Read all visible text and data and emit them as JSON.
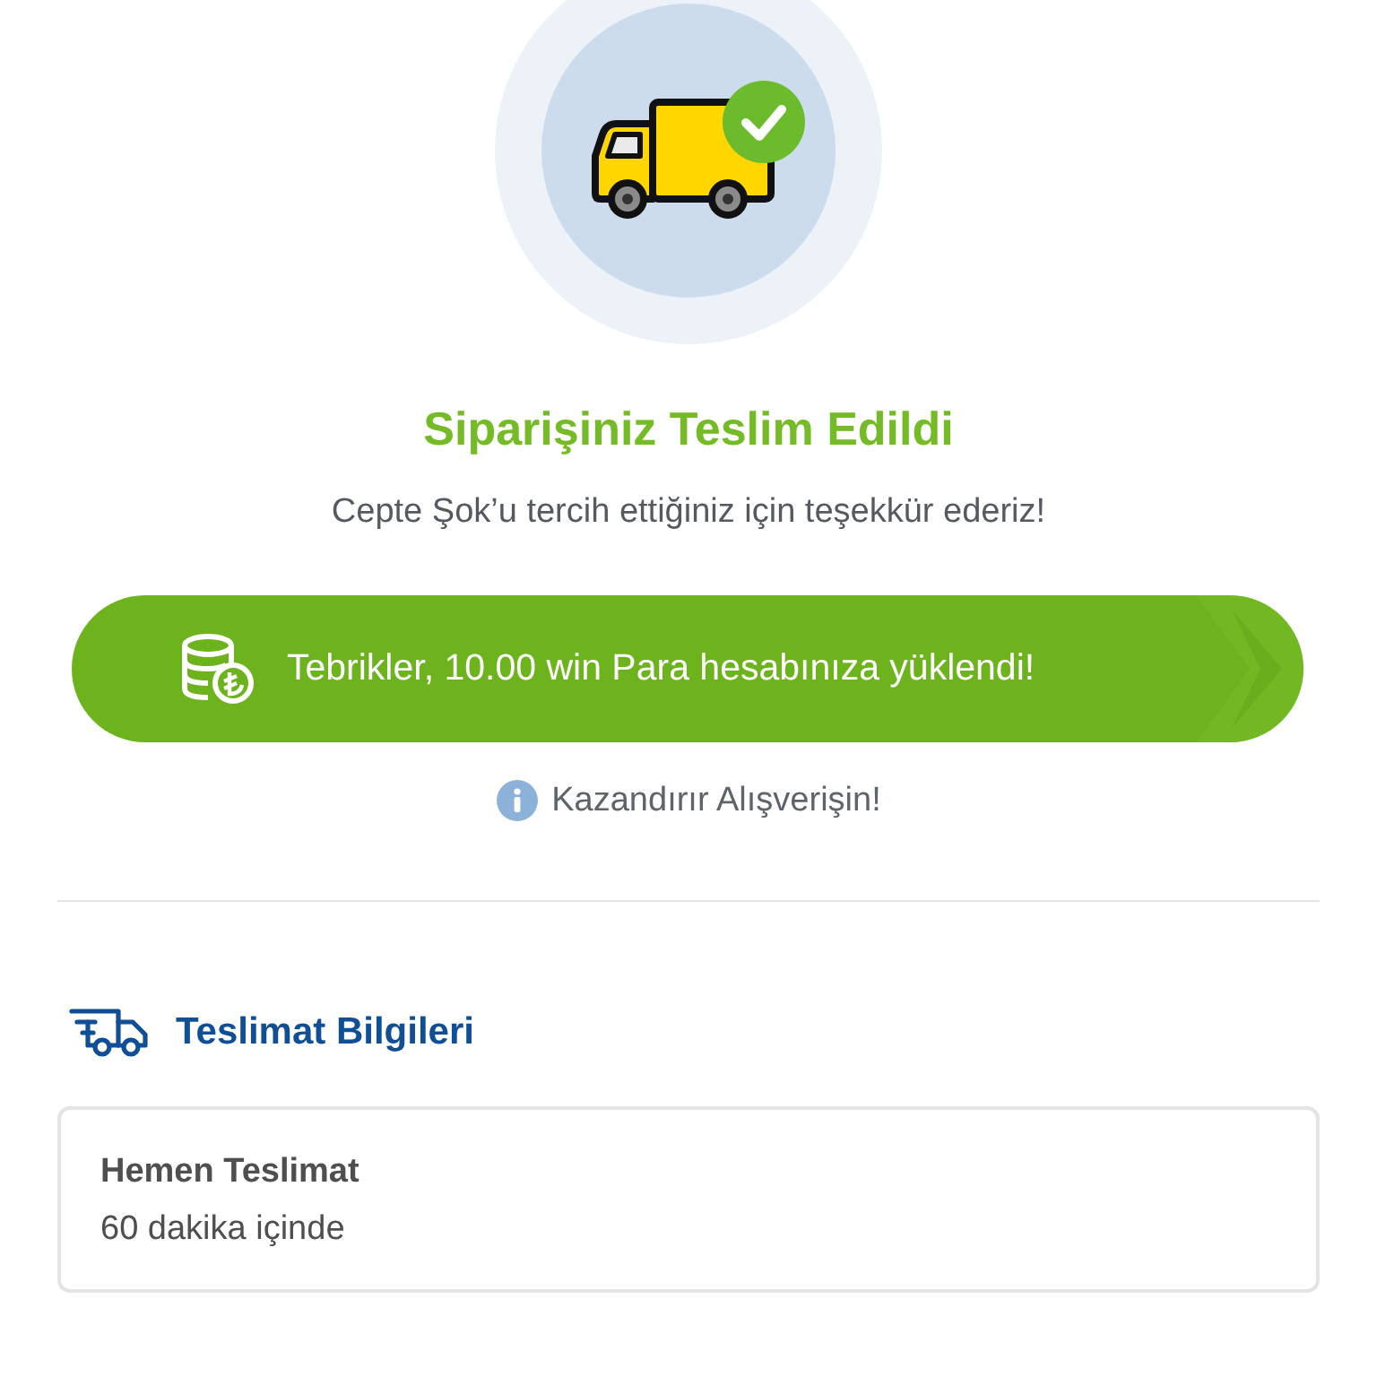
{
  "hero": {
    "title": "Siparişiniz Teslim Edildi",
    "message": "Cepte Şok’u tercih ettiğiniz için teşekkür ederiz!"
  },
  "reward_banner": {
    "text": "Tebrikler, 10.00 win Para hesabınıza yüklendi!"
  },
  "info_link": {
    "text": "Kazandırır Alışverişin!"
  },
  "delivery_section": {
    "title": "Teslimat Bilgileri",
    "card": {
      "title": "Hemen Teslimat",
      "subtitle": "60 dakika içinde"
    }
  }
}
